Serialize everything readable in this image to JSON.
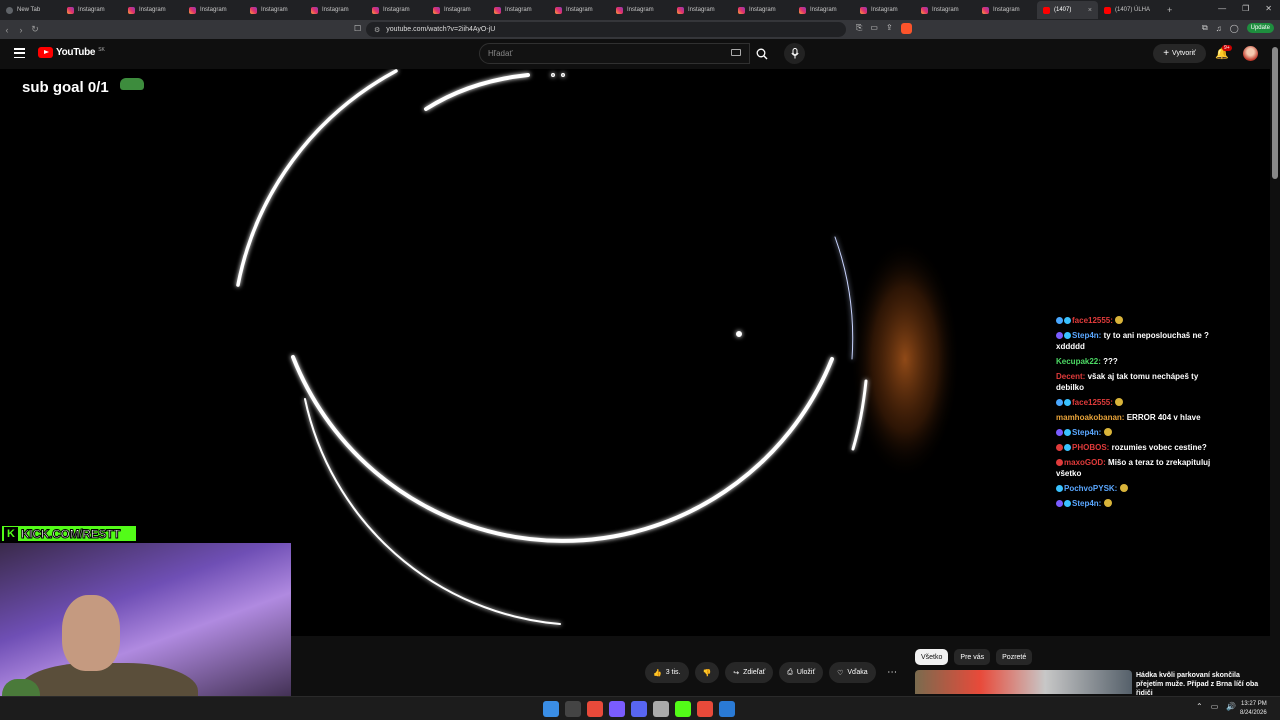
{
  "overlay": {
    "sub_goal": "sub goal 0/1",
    "kick_handle": "KICK.COM/RESTT",
    "kick_logo": "K"
  },
  "browser": {
    "tabs": [
      {
        "label": "New Tab",
        "kind": "newtab"
      },
      {
        "label": "Instagram",
        "kind": "ig"
      },
      {
        "label": "Instagram",
        "kind": "ig"
      },
      {
        "label": "Instagram",
        "kind": "ig"
      },
      {
        "label": "Instagram",
        "kind": "ig"
      },
      {
        "label": "Instagram",
        "kind": "ig"
      },
      {
        "label": "Instagram",
        "kind": "ig"
      },
      {
        "label": "Instagram",
        "kind": "ig"
      },
      {
        "label": "Instagram",
        "kind": "ig"
      },
      {
        "label": "Instagram",
        "kind": "ig"
      },
      {
        "label": "Instagram",
        "kind": "ig"
      },
      {
        "label": "Instagram",
        "kind": "ig"
      },
      {
        "label": "Instagram",
        "kind": "ig"
      },
      {
        "label": "Instagram",
        "kind": "ig"
      },
      {
        "label": "Instagram",
        "kind": "ig"
      },
      {
        "label": "Instagram",
        "kind": "ig"
      },
      {
        "label": "Instagram",
        "kind": "ig"
      },
      {
        "label": "(1407)",
        "kind": "yt-active"
      },
      {
        "label": "(1407) ÚLHA",
        "kind": "yt"
      }
    ],
    "new_tab_symbol": "+",
    "close_symbol": "×",
    "url": "youtube.com/watch?v=2iih4AyO-jU",
    "update_label": "Update"
  },
  "youtube": {
    "logo_text": "YouTube",
    "region": "SK",
    "search_placeholder": "Hľadať",
    "create_label": "Vytvoriť",
    "bell_badge": "9+"
  },
  "chat": [
    {
      "user": "face12555:",
      "text": "",
      "user_color": "#e03b3b",
      "badges": [
        "#4aa8ff",
        "#39c2ff"
      ],
      "emote": true
    },
    {
      "user": "Step4n:",
      "text": "ty to ani neposlouchaš ne ? xddddd",
      "user_color": "#5aa7ff",
      "badges": [
        "#7a5cff",
        "#39c2ff"
      ]
    },
    {
      "user": "Kecupak22:",
      "text": "???",
      "user_color": "#4cd964",
      "badges": []
    },
    {
      "user": "Decent:",
      "text": "však aj tak tomu nechápeš ty debilko",
      "user_color": "#e03b3b",
      "badges": []
    },
    {
      "user": "face12555:",
      "text": "",
      "user_color": "#e03b3b",
      "badges": [
        "#4aa8ff",
        "#39c2ff"
      ],
      "emote": true
    },
    {
      "user": "mamhoakobanan:",
      "text": "ERROR 404 v hlave",
      "user_color": "#e8a33a",
      "badges": []
    },
    {
      "user": "Step4n:",
      "text": "",
      "user_color": "#5aa7ff",
      "badges": [
        "#7a5cff",
        "#39c2ff"
      ],
      "emote": true
    },
    {
      "user": "PHOBOS:",
      "text": "rozumies vobec cestine?",
      "user_color": "#e03b3b",
      "badges": [
        "#e03b3b",
        "#39c2ff"
      ]
    },
    {
      "user": "maxoGOD:",
      "text": "Mišo a teraz to zrekapituluj všetko",
      "user_color": "#e03b3b",
      "badges": [
        "#e03b3b"
      ]
    },
    {
      "user": "PochvoPYSK:",
      "text": "",
      "user_color": "#5aa7ff",
      "badges": [
        "#39c2ff"
      ],
      "emote": true
    },
    {
      "user": "Step4n:",
      "text": "",
      "user_color": "#5aa7ff",
      "badges": [
        "#7a5cff",
        "#39c2ff"
      ],
      "emote": true
    }
  ],
  "actions": {
    "like_count": "3 tis.",
    "share": "Zdieľať",
    "save": "Uložiť",
    "thanks": "Vďaka"
  },
  "filter_chips": [
    "Všetko",
    "Pre vás",
    "Pozreté"
  ],
  "recommendation": {
    "title": "Hádka kvôli parkovaní skončila přejetím muže. Případ z Brna líčí oba řidiči"
  },
  "taskbar": {
    "time": "13:27 PM",
    "date": "8/24/2026",
    "apps": [
      "#3a8ee6",
      "#444",
      "#e84a3a",
      "#7a5cff",
      "#5865f2",
      "#aaa",
      "#53fc18",
      "#e84a3a",
      "#2a7ad5"
    ]
  },
  "colors": {
    "accent": "#ff0000",
    "kick_green": "#53fc18",
    "page_bg": "#0f0f0f"
  }
}
